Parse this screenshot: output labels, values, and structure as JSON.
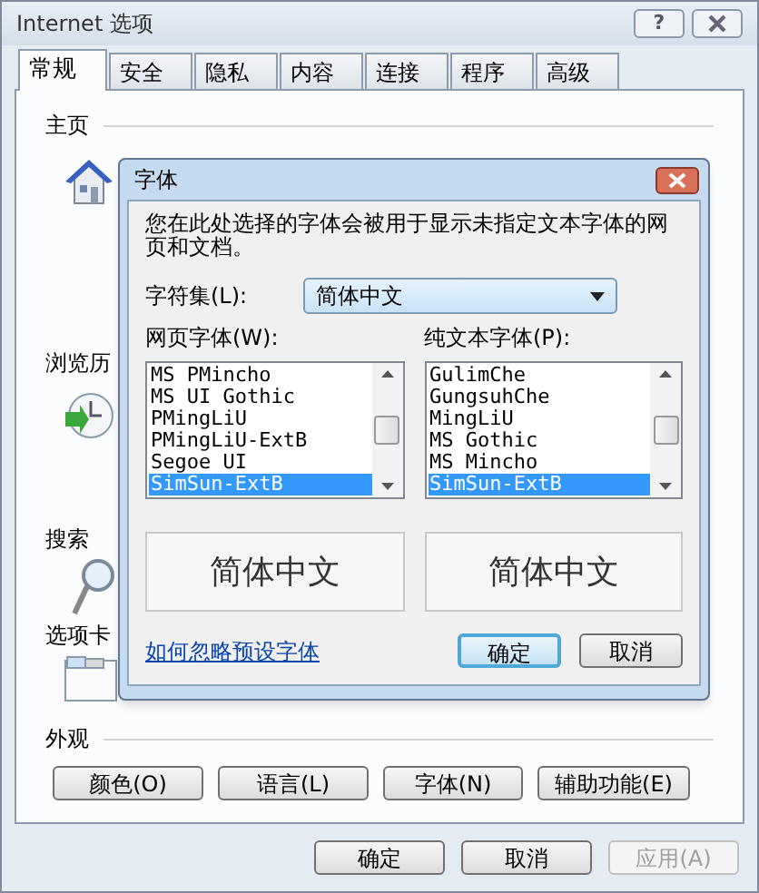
{
  "window": {
    "title": "Internet 选项",
    "help_button": "?"
  },
  "tabs": [
    {
      "label": "常规",
      "selected": true
    },
    {
      "label": "安全",
      "selected": false
    },
    {
      "label": "隐私",
      "selected": false
    },
    {
      "label": "内容",
      "selected": false
    },
    {
      "label": "连接",
      "selected": false
    },
    {
      "label": "程序",
      "selected": false
    },
    {
      "label": "高级",
      "selected": false
    }
  ],
  "home_page": {
    "title": "主页"
  },
  "browsing_history": {
    "title": "浏览历"
  },
  "search": {
    "title": "搜索"
  },
  "tabs_section": {
    "title": "选项卡"
  },
  "appearance": {
    "title": "外观",
    "buttons": [
      "颜色(O)",
      "语言(L)",
      "字体(N)",
      "辅助功能(E)"
    ]
  },
  "dialog": {
    "title": "字体",
    "description": "您在此处选择的字体会被用于显示未指定文本字体的网页和文档。",
    "charset_label": "字符集(L):",
    "charset_value": "简体中文",
    "web_font_label": "网页字体(W):",
    "plain_font_label": "纯文本字体(P):",
    "web_fonts": [
      {
        "label": "MS PMincho",
        "selected": false
      },
      {
        "label": "MS UI Gothic",
        "selected": false
      },
      {
        "label": "PMingLiU",
        "selected": false
      },
      {
        "label": "PMingLiU-ExtB",
        "selected": false
      },
      {
        "label": "Segoe UI",
        "selected": false
      },
      {
        "label": "SimSun-ExtB",
        "selected": true
      }
    ],
    "plain_fonts": [
      {
        "label": "GulimChe",
        "selected": false
      },
      {
        "label": "GungsuhChe",
        "selected": false
      },
      {
        "label": "MingLiU",
        "selected": false
      },
      {
        "label": "MS Gothic",
        "selected": false
      },
      {
        "label": "MS Mincho",
        "selected": false
      },
      {
        "label": "SimSun-ExtB",
        "selected": true
      }
    ],
    "web_preview": "简体中文",
    "plain_preview": "简体中文",
    "link": "如何忽略预设字体",
    "buttons": [
      {
        "label": "确定",
        "default": true
      },
      {
        "label": "取消",
        "default": false
      }
    ]
  },
  "footer_buttons": [
    {
      "label": "确定",
      "disabled": false
    },
    {
      "label": "取消",
      "disabled": false
    },
    {
      "label": "应用(A)",
      "disabled": true
    }
  ]
}
